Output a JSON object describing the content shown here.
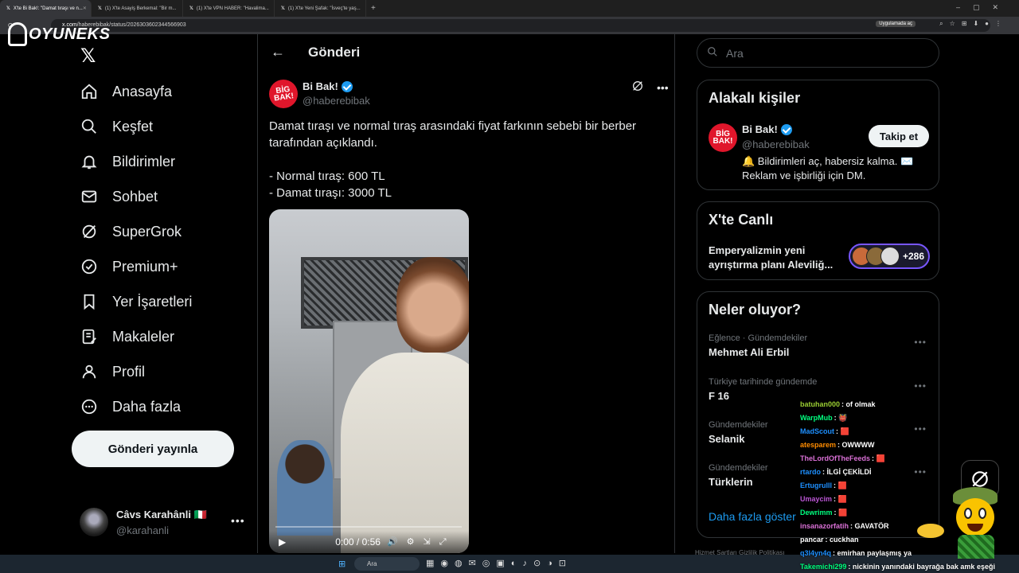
{
  "browser": {
    "tabs": [
      {
        "label": "X'te Bi Bak!: \"Damat tıraşı ve n...",
        "active": true
      },
      {
        "label": "(1) X'te Asayiş Berkemal: \"Bir m...",
        "active": false
      },
      {
        "label": "(1) X'te VPN HABER: \"Havalima...",
        "active": false
      },
      {
        "label": "(1) X'te Yeni Şafak: \"İsveç'te yaş...",
        "active": false
      }
    ],
    "url_host": "x.com",
    "url_path": "/haberebibak/status/2026303602344566903",
    "app_button": "Uygulamada aç"
  },
  "watermark": {
    "text": "OYUNEKS"
  },
  "sidebar": {
    "items": [
      {
        "label": "Anasayfa",
        "icon": "home-icon"
      },
      {
        "label": "Keşfet",
        "icon": "search-icon"
      },
      {
        "label": "Bildirimler",
        "icon": "bell-icon"
      },
      {
        "label": "Sohbet",
        "icon": "mail-icon"
      },
      {
        "label": "SuperGrok",
        "icon": "grok-icon"
      },
      {
        "label": "Premium+",
        "icon": "premium-icon"
      },
      {
        "label": "Yer İşaretleri",
        "icon": "bookmark-icon"
      },
      {
        "label": "Makaleler",
        "icon": "article-icon"
      },
      {
        "label": "Profil",
        "icon": "profile-icon"
      },
      {
        "label": "Daha fazla",
        "icon": "more-icon"
      }
    ],
    "post_button": "Gönderi yayınla",
    "account": {
      "name": "Câvs Karahânli 🇮🇹",
      "handle": "@karahanli"
    }
  },
  "main": {
    "title": "Gönderi",
    "post": {
      "author_name": "Bi Bak!",
      "author_handle": "@haberebibak",
      "avatar_text": "BİG BAK!",
      "text_line1": "Damat tıraşı ve normal tıraş arasındaki fiyat farkının sebebi bir berber tarafından açıklandı.",
      "text_line2": "- Normal tıraş: 600 TL",
      "text_line3": "- Damat tıraşı: 3000 TL",
      "video_time": "0:00 / 0:56",
      "video_progress": 0
    }
  },
  "right": {
    "search_placeholder": "Ara",
    "related": {
      "title": "Alakalı kişiler",
      "name": "Bi Bak!",
      "handle": "@haberebibak",
      "follow": "Takip et",
      "bio": "🔔 Bildirimleri aç, habersiz kalma. ✉️ Reklam ve işbirliği için DM."
    },
    "live": {
      "title": "X'te Canlı",
      "text": "Emperyalizmin yeni ayrıştırma planı Aleviliğ...",
      "count": "+286"
    },
    "trends": {
      "title": "Neler oluyor?",
      "items": [
        {
          "context": "Eğlence · Gündemdekiler",
          "name": "Mehmet Ali Erbil"
        },
        {
          "context": "Türkiye tarihinde gündemde",
          "name": "F 16"
        },
        {
          "context": "Gündemdekiler",
          "name": "Selanik"
        },
        {
          "context": "Gündemdekiler",
          "name": "Türklerin"
        }
      ],
      "show_more": "Daha fazla göster"
    },
    "footer": "Hizmet Şartları   Gizlilik Politikası"
  },
  "chat": {
    "messages": [
      {
        "user": "batuhan000",
        "text": "of olmak",
        "color": "#9acd32"
      },
      {
        "user": "WarpMub",
        "text": "👹",
        "color": "#00ff7f"
      },
      {
        "user": "MadScout",
        "text": "🟥",
        "color": "#1e90ff"
      },
      {
        "user": "atesparem",
        "text": "OWWWW",
        "color": "#ff8c00"
      },
      {
        "user": "TheLordOfTheFeeds",
        "text": "🟥",
        "color": "#da70d6"
      },
      {
        "user": "rtardo",
        "text": "İLGİ ÇEKİLDİ",
        "color": "#1e90ff"
      },
      {
        "user": "Ertugrulll",
        "text": "🟥",
        "color": "#1e90ff"
      },
      {
        "user": "Umaycim",
        "text": "🟥",
        "color": "#ba55d3"
      },
      {
        "user": "Dewrimm",
        "text": "🟥",
        "color": "#00ff7f"
      },
      {
        "user": "insanazorfatih",
        "text": "GAVATÖR",
        "color": "#da70d6"
      },
      {
        "user": "pancar",
        "text": "cuckhan",
        "color": "#ffffff"
      },
      {
        "user": "q3l4yn4q",
        "text": "emirhan paylaşmış ya",
        "color": "#1e90ff"
      },
      {
        "user": "Takemichi299",
        "text": "nickinin yanındaki bayrağa bak amk eşeği",
        "color": "#00ff7f"
      }
    ]
  },
  "taskbar": {
    "search": "Ara"
  },
  "colors": {
    "accent": "#1d9bf0",
    "background": "#000000",
    "border": "#2f3336",
    "muted": "#71767b"
  }
}
